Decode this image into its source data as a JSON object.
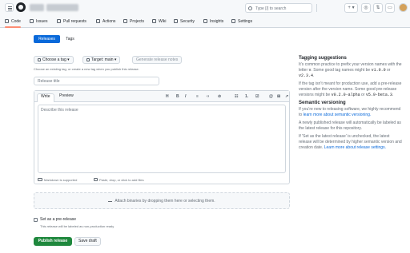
{
  "header": {
    "search_placeholder": "Type [/] to search",
    "plus_label": "+ ▾",
    "issues_icon": "◎",
    "pr_icon": "⇅",
    "inbox_icon": "▭"
  },
  "repo_tabs": [
    {
      "label": "Code",
      "icon": "code-icon"
    },
    {
      "label": "Issues",
      "icon": "issue-icon"
    },
    {
      "label": "Pull requests",
      "icon": "pull-request-icon"
    },
    {
      "label": "Actions",
      "icon": "actions-icon"
    },
    {
      "label": "Projects",
      "icon": "projects-icon"
    },
    {
      "label": "Wiki",
      "icon": "wiki-icon"
    },
    {
      "label": "Security",
      "icon": "shield-icon"
    },
    {
      "label": "Insights",
      "icon": "graph-icon"
    },
    {
      "label": "Settings",
      "icon": "gear-icon"
    }
  ],
  "segmented": {
    "releases": "Releases",
    "tags": "Tags"
  },
  "form": {
    "choose_tag": "Choose a tag",
    "target": "Target: main",
    "generate_notes": "Generate release notes",
    "tag_hint": "Choose an existing tag, or create a new tag when you publish this release.",
    "title_placeholder": "Release title",
    "write_tab": "Write",
    "preview_tab": "Preview",
    "describe_placeholder": "Describe this release",
    "markdown_supported": "Markdown is supported",
    "paste_drop": "Paste, drop, or click to add files",
    "attach_binaries": "Attach binaries by dropping them here or selecting them.",
    "prerelease_label": "Set as a pre-release",
    "prerelease_hint": "This release will be labeled as non-production ready",
    "publish": "Publish release",
    "save_draft": "Save draft"
  },
  "toolbar": [
    "H",
    "B",
    "I",
    "≡",
    "‹›",
    "⊘",
    "☷",
    "1.",
    "☑",
    "@",
    "⊞",
    "↗",
    "↶"
  ],
  "sidebar": {
    "tagging_title": "Tagging suggestions",
    "tagging_p1_a": "It’s common practice to prefix your version names with the letter ",
    "tagging_p1_v": "v",
    "tagging_p1_b": ". Some good tag names might be ",
    "tagging_p1_c1": "v1.0.0",
    "tagging_p1_or": " or ",
    "tagging_p1_c2": "v2.3.4",
    "tagging_p1_end": ".",
    "tagging_p2_a": "If the tag isn’t meant for production use, add a pre-release version after the version name. Some good pre-release versions might be ",
    "tagging_p2_c1": "v0.2.0-alpha",
    "tagging_p2_or": " or ",
    "tagging_p2_c2": "v5.9-beta.3",
    "tagging_p2_end": ".",
    "semver_title": "Semantic versioning",
    "semver_a": "If you’re new to releasing software, we highly recommend to ",
    "semver_link": "learn more about semantic versioning.",
    "semver_p2": "A newly published release will automatically be labeled as the latest release for this repository.",
    "latest_a": "If 'Set as the latest release' is unchecked, the latest release will be determined by higher semantic version and creation date. ",
    "latest_link": "Learn more about release settings."
  },
  "colors": {
    "accent": "#0969da",
    "primary": "#1f883d",
    "tab_underline": "#fd8c73"
  }
}
